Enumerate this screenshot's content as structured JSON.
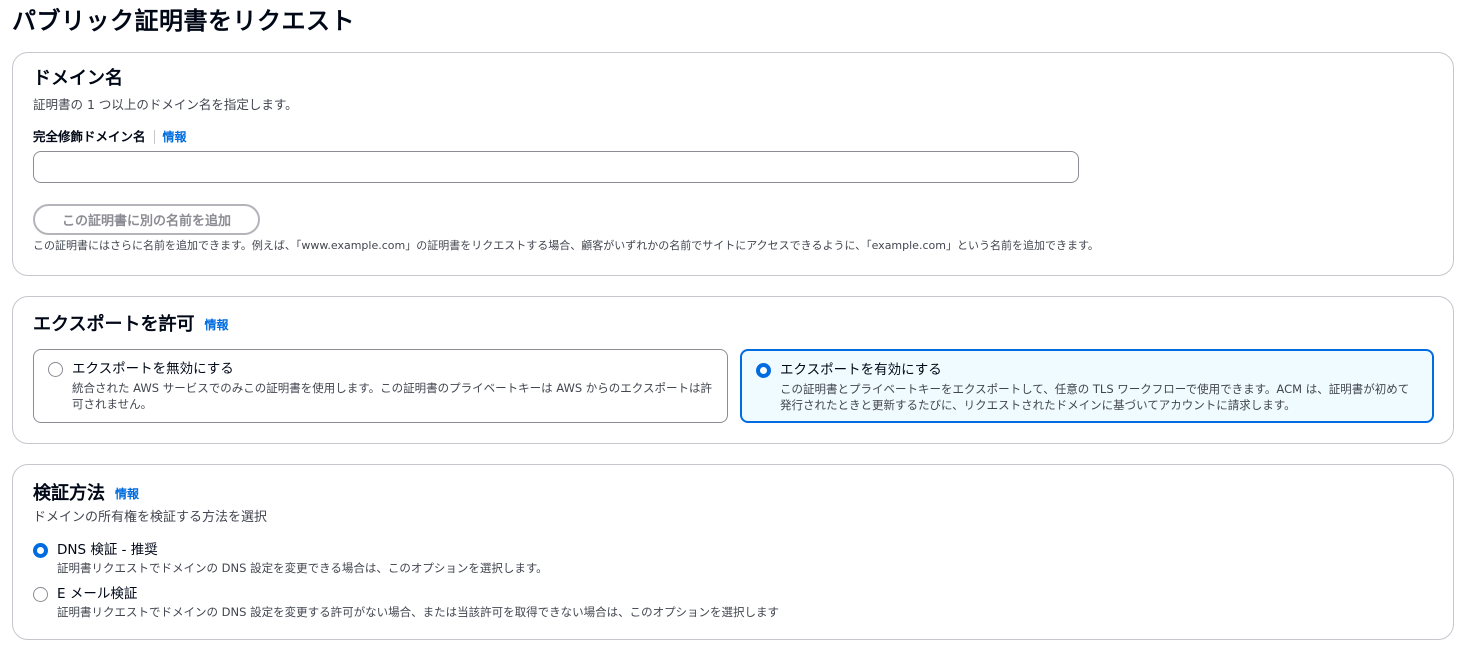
{
  "page": {
    "title": "パブリック証明書をリクエスト"
  },
  "domain_section": {
    "title": "ドメイン名",
    "description": "証明書の 1 つ以上のドメイン名を指定します。",
    "fqdn_label": "完全修飾ドメイン名",
    "info_label": "情報",
    "fqdn_value": "",
    "add_name_button": "この証明書に別の名前を追加",
    "hint": "この証明書にはさらに名前を追加できます。例えば、「www.example.com」の証明書をリクエストする場合、顧客がいずれかの名前でサイトにアクセスできるように、「example.com」という名前を追加できます。"
  },
  "export_section": {
    "title": "エクスポートを許可",
    "info_label": "情報",
    "options": [
      {
        "title": "エクスポートを無効にする",
        "description": "統合された AWS サービスでのみこの証明書を使用します。この証明書のプライベートキーは AWS からのエクスポートは許可されません。",
        "selected": false
      },
      {
        "title": "エクスポートを有効にする",
        "description": "この証明書とプライベートキーをエクスポートして、任意の TLS ワークフローで使用できます。ACM は、証明書が初めて発行されたときと更新するたびに、リクエストされたドメインに基づいてアカウントに請求します。",
        "selected": true
      }
    ]
  },
  "validation_section": {
    "title": "検証方法",
    "info_label": "情報",
    "description": "ドメインの所有権を検証する方法を選択",
    "options": [
      {
        "title": "DNS 検証 - 推奨",
        "description": "証明書リクエストでドメインの DNS 設定を変更できる場合は、このオプションを選択します。",
        "selected": true
      },
      {
        "title": "E メール検証",
        "description": "証明書リクエストでドメインの DNS 設定を変更する許可がない場合、または当該許可を取得できない場合は、このオプションを選択します",
        "selected": false
      }
    ]
  },
  "colors": {
    "accent": "#006ce0",
    "border": "#c6c6cd",
    "selected_bg": "#f0fbff",
    "text": "#000716",
    "muted": "#424650"
  }
}
